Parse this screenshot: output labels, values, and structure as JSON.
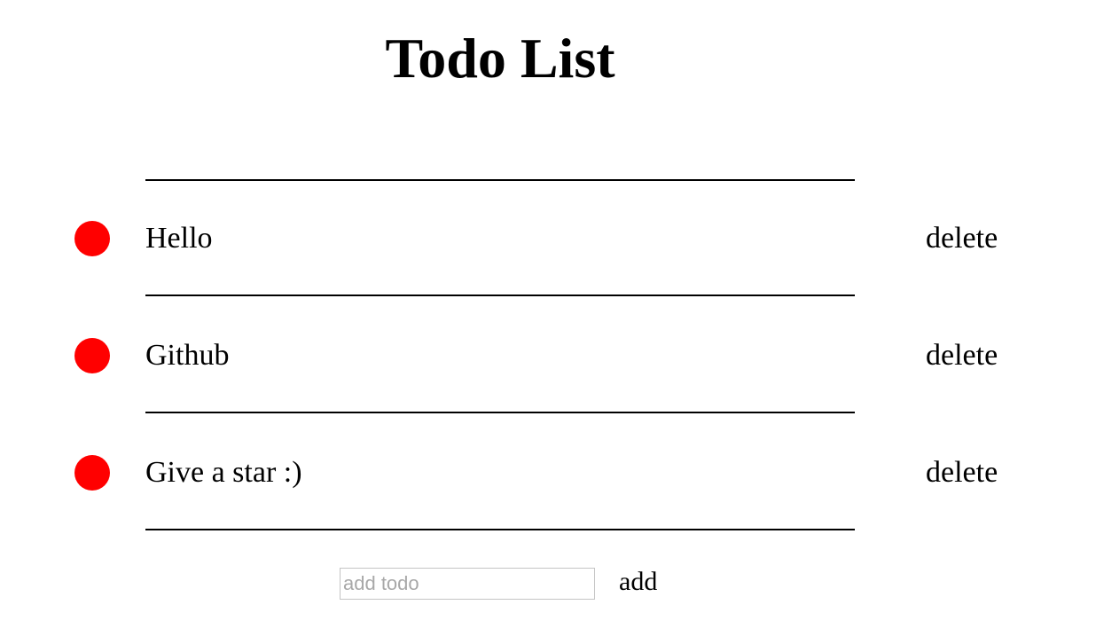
{
  "app": {
    "title": "Todo List"
  },
  "todos": [
    {
      "text": "Hello",
      "delete_label": "delete"
    },
    {
      "text": "Github",
      "delete_label": "delete"
    },
    {
      "text": "Give a star :)",
      "delete_label": "delete"
    }
  ],
  "add_form": {
    "placeholder": "add todo",
    "value": "",
    "button_label": "add"
  },
  "colors": {
    "status_dot": "#ff0000",
    "divider": "#000000"
  },
  "icons": {
    "status": "red-circle-icon"
  }
}
